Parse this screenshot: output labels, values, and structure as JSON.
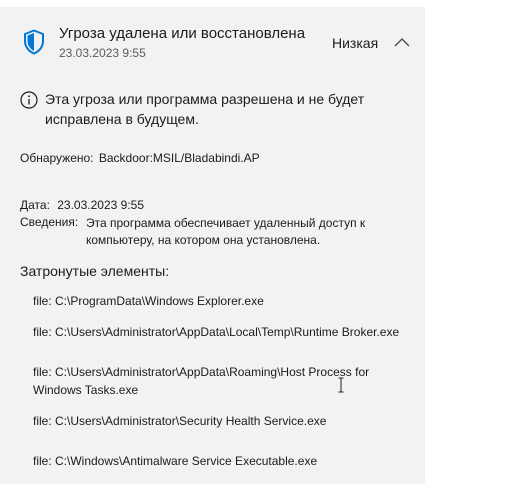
{
  "threat": {
    "title": "Угроза удалена или восстановлена",
    "date": "23.03.2023 9:55",
    "severity": "Низкая"
  },
  "info_message": "Эта угроза или программа разрешена и не будет исправлена в будущем.",
  "details": {
    "detected_label": "Обнаружено:",
    "detected_value": "Backdoor:MSIL/Bladabindi.AP",
    "date_label": "Дата:",
    "date_value": "23.03.2023 9:55",
    "info_label": "Сведения:",
    "info_value": "Эта программа обеспечивает удаленный доступ к компьютеру, на котором она установлена."
  },
  "affected": {
    "title": "Затронутые элементы:",
    "items": [
      "file: C:\\ProgramData\\Windows Explorer.exe",
      "file: C:\\Users\\Administrator\\AppData\\Local\\Temp\\Runtime Broker.exe",
      "file: C:\\Users\\Administrator\\AppData\\Roaming\\Host Process for Windows Tasks.exe",
      "file: C:\\Users\\Administrator\\Security Health Service.exe",
      "file: C:\\Windows\\Antimalware Service Executable.exe"
    ]
  },
  "icons": {
    "shield": "shield-icon",
    "chevron": "chevron-up-icon",
    "info": "info-icon",
    "cursor": "text-cursor-icon"
  },
  "colors": {
    "accent": "#0078d4",
    "card_bg": "#f2f2f2"
  }
}
